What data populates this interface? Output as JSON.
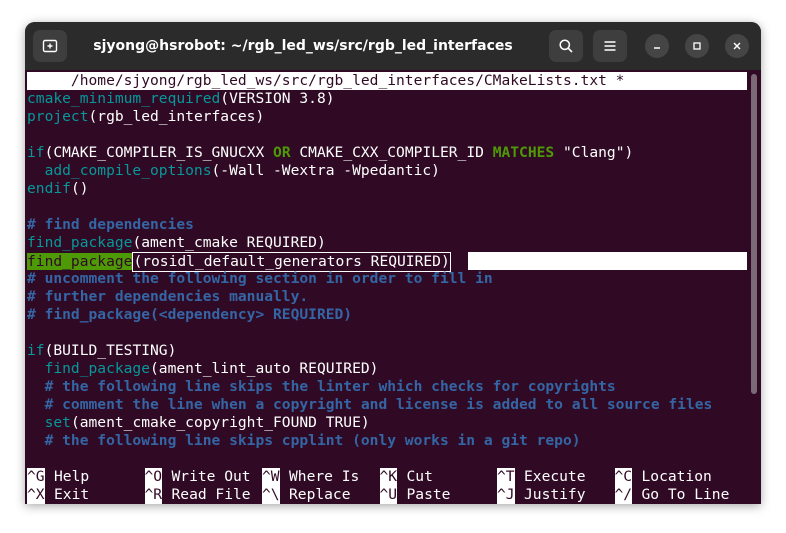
{
  "window": {
    "title": "sjyong@hsrobot: ~/rgb_led_ws/src/rgb_led_interfaces"
  },
  "editor": {
    "header": "     /home/sjyong/rgb_led_ws/src/rgb_led_interfaces/CMakeLists.txt *",
    "lines": [
      [
        {
          "t": "cmake_minimum_required",
          "c": "cyan"
        },
        {
          "t": "(VERSION 3.8)",
          "c": "white"
        }
      ],
      [
        {
          "t": "project",
          "c": "cyan"
        },
        {
          "t": "(rgb_led_interfaces)",
          "c": "white"
        }
      ],
      [],
      [
        {
          "t": "if",
          "c": "cyan"
        },
        {
          "t": "(CMAKE_COMPILER_IS_GNUCXX ",
          "c": "white"
        },
        {
          "t": "OR",
          "c": "green"
        },
        {
          "t": " CMAKE_CXX_COMPILER_ID ",
          "c": "white"
        },
        {
          "t": "MATCHES",
          "c": "green"
        },
        {
          "t": " \"Clang\")",
          "c": "white"
        }
      ],
      [
        {
          "t": "  add_compile_options",
          "c": "cyan"
        },
        {
          "t": "(-Wall -Wextra -Wpedantic)",
          "c": "white"
        }
      ],
      [
        {
          "t": "endif",
          "c": "cyan"
        },
        {
          "t": "()",
          "c": "white"
        }
      ],
      [],
      [
        {
          "t": "# find dependencies",
          "c": "comment"
        }
      ],
      [
        {
          "t": "find_package",
          "c": "cyan"
        },
        {
          "t": "(ament_cmake REQUIRED)",
          "c": "white"
        }
      ],
      [
        {
          "t": "find_package",
          "c": "hlgreen"
        },
        {
          "t": "(rosidl_default_generators REQUIRED)",
          "c": "cursorbox"
        }
      ],
      [
        {
          "t": "# uncomment the following section in order to fill in",
          "c": "comment"
        }
      ],
      [
        {
          "t": "# further dependencies manually.",
          "c": "comment"
        }
      ],
      [
        {
          "t": "# find_package(<dependency> REQUIRED)",
          "c": "comment"
        }
      ],
      [],
      [
        {
          "t": "if",
          "c": "cyan"
        },
        {
          "t": "(BUILD_TESTING)",
          "c": "white"
        }
      ],
      [
        {
          "t": "  find_package",
          "c": "cyan"
        },
        {
          "t": "(ament_lint_auto REQUIRED)",
          "c": "white"
        }
      ],
      [
        {
          "t": "  # the following line skips the linter which checks for copyrights",
          "c": "comment"
        }
      ],
      [
        {
          "t": "  # comment the line when a copyright and license is added to all source files",
          "c": "comment"
        }
      ],
      [
        {
          "t": "  set",
          "c": "cyan"
        },
        {
          "t": "(ament_cmake_copyright_FOUND TRUE)",
          "c": "white"
        }
      ],
      [
        {
          "t": "  # the following line skips cpplint (only works in a git repo)",
          "c": "comment"
        }
      ]
    ]
  },
  "shortcuts": {
    "row1": [
      {
        "key": "^G",
        "label": "Help"
      },
      {
        "key": "^O",
        "label": "Write Out"
      },
      {
        "key": "^W",
        "label": "Where Is"
      },
      {
        "key": "^K",
        "label": "Cut"
      },
      {
        "key": "^T",
        "label": "Execute"
      },
      {
        "key": "^C",
        "label": "Location"
      }
    ],
    "row2": [
      {
        "key": "^X",
        "label": "Exit"
      },
      {
        "key": "^R",
        "label": "Read File"
      },
      {
        "key": "^\\",
        "label": "Replace"
      },
      {
        "key": "^U",
        "label": "Paste"
      },
      {
        "key": "^J",
        "label": "Justify"
      },
      {
        "key": "^/",
        "label": "Go To Line"
      }
    ]
  },
  "colors": {
    "terminal_bg": "#300a24",
    "titlebar_bg": "#2b2b2b",
    "keyword_cyan": "#06989a",
    "keyword_green": "#4e9a06",
    "comment_blue": "#3465a4"
  },
  "icons": {
    "new_tab": "new-tab-icon",
    "search": "search-icon",
    "menu": "hamburger-menu-icon",
    "minimize": "minimize-icon",
    "maximize": "maximize-icon",
    "close": "close-icon"
  }
}
